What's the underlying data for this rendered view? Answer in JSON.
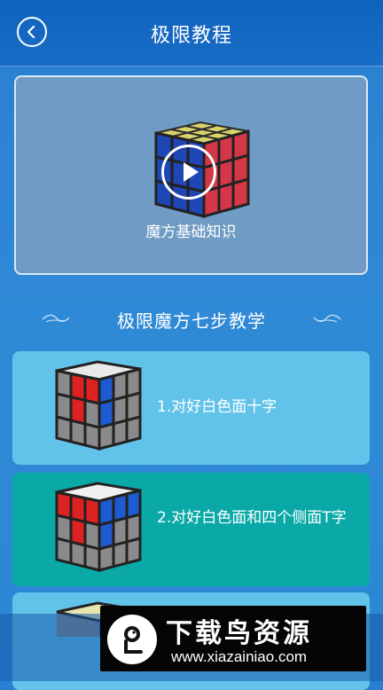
{
  "header": {
    "title": "极限教程",
    "back_icon": "back-arrow-icon"
  },
  "video": {
    "label": "魔方基础知识",
    "play_icon": "play-icon"
  },
  "section": {
    "title": "极限魔方七步教学"
  },
  "steps": [
    {
      "label": "1.对好白色面十字"
    },
    {
      "label": "2.对好白色面和四个侧面T字"
    },
    {
      "label": ""
    }
  ],
  "watermark": {
    "title": "下载鸟资源",
    "url": "www.xiazainiao.com"
  },
  "colors": {
    "header": "#0f63bd",
    "background": "#2b86d4",
    "card_light": "#62c3ea",
    "card_teal": "#0aa9a8"
  }
}
